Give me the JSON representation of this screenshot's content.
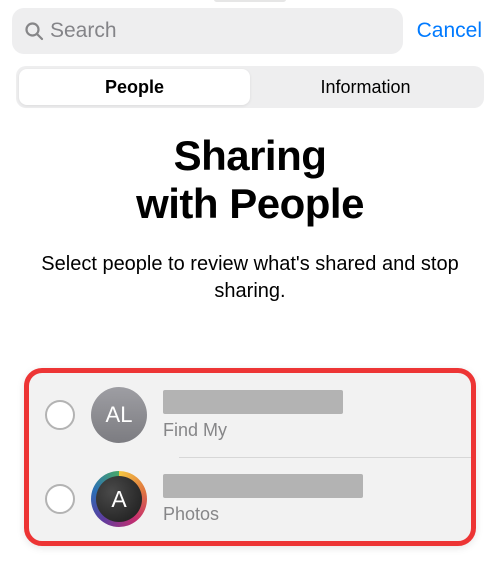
{
  "topbar": {
    "search_placeholder": "Search",
    "cancel_label": "Cancel"
  },
  "segments": {
    "people": "People",
    "information": "Information"
  },
  "heading_line1": "Sharing",
  "heading_line2": "with People",
  "subheading": "Select people to review what's shared and stop sharing.",
  "people": [
    {
      "avatar_initials": "AL",
      "app": "Find My"
    },
    {
      "avatar_initials": "A",
      "app": "Photos"
    }
  ]
}
